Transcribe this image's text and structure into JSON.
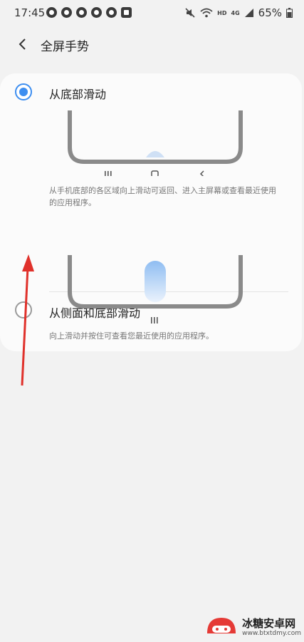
{
  "status": {
    "time": "17:45",
    "hd": "HD",
    "network": "4G",
    "battery": "65%"
  },
  "header": {
    "title": "全屏手势"
  },
  "options": [
    {
      "label": "从底部滑动",
      "selected": true,
      "description": "从手机底部的各区域向上滑动可返回、进入主屏幕或查看最近使用的应用程序。"
    },
    {
      "label": "从侧面和底部滑动",
      "selected": false,
      "description": "向上滑动并按住可查看您最近使用的应用程序。"
    }
  ],
  "watermark": {
    "title": "冰糖安卓网",
    "url": "www.btxtdmy.com"
  },
  "colors": {
    "accent": "#3d8ef0",
    "arrow": "#e0312b",
    "phone_frame": "#888888"
  }
}
